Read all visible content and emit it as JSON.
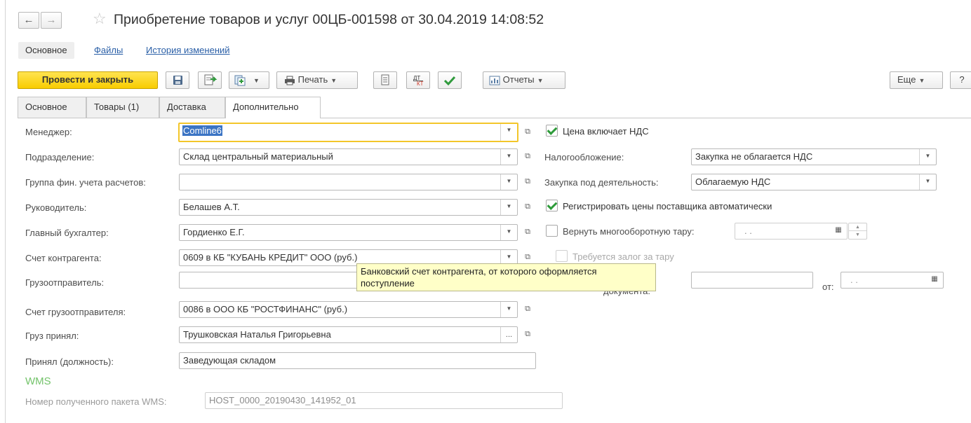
{
  "header": {
    "back_icon": "arrow-left-icon",
    "forward_icon": "arrow-right-icon",
    "favorite_icon": "star-icon",
    "title": "Приобретение товаров и услуг 00ЦБ-001598 от 30.04.2019 14:08:52"
  },
  "form_tabs": [
    {
      "label": "Основное"
    },
    {
      "label": "Файлы"
    },
    {
      "label": "История изменений"
    }
  ],
  "toolbar": {
    "post_close": "Провести и закрыть",
    "print": "Печать",
    "reports": "Отчеты",
    "more": "Еще",
    "help": "?"
  },
  "page_tabs": [
    {
      "label": "Основное"
    },
    {
      "label": "Товары (1)"
    },
    {
      "label": "Доставка"
    },
    {
      "label": "Дополнительно"
    }
  ],
  "fields": {
    "manager": {
      "label": "Менеджер:",
      "value": "Comline6"
    },
    "division": {
      "label": "Подразделение:",
      "value": "Склад центральный материальный"
    },
    "fin_group": {
      "label": "Группа фин. учета расчетов:",
      "value": ""
    },
    "head": {
      "label": "Руководитель:",
      "value": "Белашев А.Т."
    },
    "chief_accountant": {
      "label": "Главный бухгалтер:",
      "value": "Гордиенко Е.Г."
    },
    "counterparty_account": {
      "label": "Счет контрагента:",
      "value": "0609 в КБ \"КУБАНЬ КРЕДИТ\" ООО (руб.)"
    },
    "shipper": {
      "label": "Грузоотправитель:",
      "value": ""
    },
    "shipper_account": {
      "label": "Счет грузоотправителя:",
      "value": "0086 в ООО КБ \"РОСТФИНАНС\" (руб.)"
    },
    "received_by": {
      "label": "Груз принял:",
      "value": "Трушковская Наталья Григорьевна"
    },
    "received_position": {
      "label": "Принял (должность):",
      "value": "Заведующая складом"
    }
  },
  "right": {
    "price_includes_vat": {
      "label": "Цена включает НДС",
      "checked": true
    },
    "taxation": {
      "label": "Налогообложение:",
      "value": "Закупка не облагается НДС"
    },
    "purchase_activity": {
      "label": "Закупка под деятельность:",
      "value": "Облагаемую НДС"
    },
    "register_prices": {
      "label": "Регистрировать цены поставщика автоматически",
      "checked": true
    },
    "return_tare": {
      "label": "Вернуть многооборотную тару:",
      "checked": false,
      "date_placeholder": ". ."
    },
    "tare_deposit": {
      "label": "Требуется залог за тару",
      "checked": false
    },
    "doc_label_partial": "документа:",
    "doc_date_label": "от:",
    "doc_date_placeholder": ". ."
  },
  "tooltip": {
    "line1": "Банковский счет контрагента, от которого оформляется",
    "line2": "поступление"
  },
  "wms": {
    "heading": "WMS",
    "package_label": "Номер полученного пакета WMS:",
    "package_value": "HOST_0000_20190430_141952_01"
  }
}
